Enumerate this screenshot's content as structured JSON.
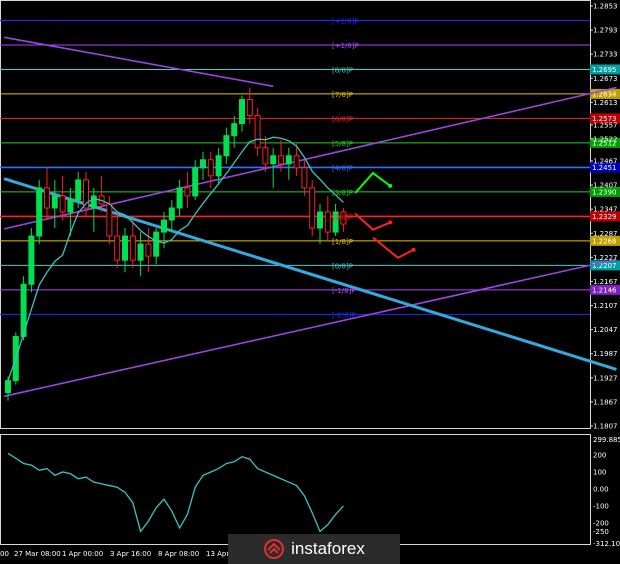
{
  "chart_data": [
    {
      "type": "candlestick",
      "title": "",
      "price_axis_ticks": [
        "1.2853",
        "1.2793",
        "1.2733",
        "1.2673",
        "1.2613",
        "1.2557",
        "1.2522",
        "1.2467",
        "1.2407",
        "1.2347",
        "1.2287",
        "1.2227",
        "1.2167",
        "1.2107",
        "1.2047",
        "1.1987",
        "1.1927",
        "1.1867",
        "1.1807"
      ],
      "time_axis_ticks": [
        "00",
        "27 Mar 08:00",
        "1 Apr 00:00",
        "3 Apr 16:00",
        "8 Apr 08:00",
        "13 Apr"
      ],
      "ylim": [
        1.1807,
        1.2853
      ],
      "grid": false,
      "price_tags": [
        {
          "value": "1.2695",
          "color": "#00a0a0"
        },
        {
          "value": "1.2634",
          "color": "#c0a000"
        },
        {
          "value": "1.2573",
          "color": "#c00000"
        },
        {
          "value": "1.2512",
          "color": "#00a000"
        },
        {
          "value": "1.2451",
          "color": "#0000c0"
        },
        {
          "value": "1.2390",
          "color": "#00a000"
        },
        {
          "value": "1.2329",
          "color": "#c00000"
        },
        {
          "value": "1.2268",
          "color": "#c0a000"
        },
        {
          "value": "1.2207",
          "color": "#00a0a0"
        },
        {
          "value": "1.2146",
          "color": "#8020c0"
        }
      ],
      "murrey_labels": [
        {
          "text": "[+2/8]P",
          "price": 1.2817,
          "color": "#1e2dff"
        },
        {
          "text": "[+1/8]P",
          "price": 1.2756,
          "color": "#b040ff"
        },
        {
          "text": "[8/8]P",
          "price": 1.2695,
          "color": "#40d0d0"
        },
        {
          "text": "[7/8]P",
          "price": 1.2634,
          "color": "#e6c200"
        },
        {
          "text": "[6/8]P",
          "price": 1.2573,
          "color": "#ff2020"
        },
        {
          "text": "[5/8]P",
          "price": 1.2512,
          "color": "#20d020"
        },
        {
          "text": "[4/8]P",
          "price": 1.2451,
          "color": "#3070ff"
        },
        {
          "text": "[3/8]P",
          "price": 1.239,
          "color": "#20d020"
        },
        {
          "text": "[2/8]P",
          "price": 1.2329,
          "color": "#ff2020"
        },
        {
          "text": "[1/8]P",
          "price": 1.2268,
          "color": "#e6c200"
        },
        {
          "text": "[0/8]P",
          "price": 1.2207,
          "color": "#40d0d0"
        },
        {
          "text": "[-1/8]P",
          "price": 1.2146,
          "color": "#b040ff"
        },
        {
          "text": "[-2/8]P",
          "price": 1.2085,
          "color": "#1e2dff"
        }
      ],
      "moving_average": {
        "color": "#40c0c0"
      },
      "trend_lines": [
        {
          "color": "#9b45e0",
          "from": [
            -0.5,
            1.2775
          ],
          "to": [
            34,
            1.2653
          ]
        },
        {
          "color": "#9b45e0",
          "from": [
            -0.5,
            1.2298
          ],
          "to": [
            78,
            1.265
          ]
        },
        {
          "color": "#9b45e0",
          "from": [
            -0.5,
            1.1881
          ],
          "to": [
            78,
            1.2222
          ]
        },
        {
          "color": "#33aadd",
          "from": [
            -0.5,
            1.2423
          ],
          "to": [
            78,
            1.1948
          ]
        }
      ],
      "forecast_arrows": [
        {
          "color": "#00ff00",
          "points": [
            [
              44.5,
              1.2387
            ],
            [
              46.8,
              1.2437
            ],
            [
              49.0,
              1.2405
            ]
          ]
        },
        {
          "color": "#ff2020",
          "points": [
            [
              44.5,
              1.2336
            ],
            [
              46.8,
              1.2296
            ],
            [
              49.0,
              1.2314
            ]
          ]
        },
        {
          "color": "#ff2020",
          "points": [
            [
              46.8,
              1.2276
            ],
            [
              50.0,
              1.2226
            ],
            [
              52.0,
              1.2246
            ]
          ]
        }
      ],
      "candles": [
        [
          1.189,
          1.193,
          1.187,
          1.192
        ],
        [
          1.192,
          1.204,
          1.191,
          1.203
        ],
        [
          1.203,
          1.218,
          1.202,
          1.216
        ],
        [
          1.216,
          1.23,
          1.214,
          1.228
        ],
        [
          1.228,
          1.242,
          1.226,
          1.24
        ],
        [
          1.24,
          1.245,
          1.232,
          1.235
        ],
        [
          1.235,
          1.242,
          1.23,
          1.238
        ],
        [
          1.238,
          1.243,
          1.232,
          1.234
        ],
        [
          1.234,
          1.24,
          1.228,
          1.237
        ],
        [
          1.237,
          1.244,
          1.235,
          1.242
        ],
        [
          1.242,
          1.244,
          1.233,
          1.235
        ],
        [
          1.235,
          1.24,
          1.229,
          1.238
        ],
        [
          1.238,
          1.243,
          1.234,
          1.236
        ],
        [
          1.236,
          1.238,
          1.226,
          1.228
        ],
        [
          1.228,
          1.234,
          1.22,
          1.222
        ],
        [
          1.222,
          1.23,
          1.219,
          1.228
        ],
        [
          1.228,
          1.232,
          1.22,
          1.222
        ],
        [
          1.222,
          1.229,
          1.218,
          1.226
        ],
        [
          1.226,
          1.23,
          1.219,
          1.223
        ],
        [
          1.223,
          1.23,
          1.221,
          1.229
        ],
        [
          1.229,
          1.234,
          1.225,
          1.232
        ],
        [
          1.232,
          1.237,
          1.229,
          1.235
        ],
        [
          1.235,
          1.242,
          1.233,
          1.24
        ],
        [
          1.24,
          1.244,
          1.235,
          1.238
        ],
        [
          1.238,
          1.247,
          1.237,
          1.245
        ],
        [
          1.245,
          1.249,
          1.242,
          1.247
        ],
        [
          1.247,
          1.249,
          1.24,
          1.243
        ],
        [
          1.243,
          1.25,
          1.241,
          1.248
        ],
        [
          1.248,
          1.255,
          1.246,
          1.253
        ],
        [
          1.253,
          1.258,
          1.25,
          1.256
        ],
        [
          1.256,
          1.263,
          1.254,
          1.262
        ],
        [
          1.262,
          1.265,
          1.256,
          1.258
        ],
        [
          1.258,
          1.26,
          1.248,
          1.25
        ],
        [
          1.25,
          1.253,
          1.244,
          1.246
        ],
        [
          1.246,
          1.25,
          1.24,
          1.248
        ],
        [
          1.248,
          1.252,
          1.244,
          1.246
        ],
        [
          1.246,
          1.25,
          1.242,
          1.248
        ],
        [
          1.248,
          1.251,
          1.243,
          1.245
        ],
        [
          1.245,
          1.247,
          1.238,
          1.24
        ],
        [
          1.24,
          1.242,
          1.228,
          1.23
        ],
        [
          1.23,
          1.236,
          1.226,
          1.234
        ],
        [
          1.234,
          1.238,
          1.227,
          1.229
        ],
        [
          1.229,
          1.236,
          1.228,
          1.234
        ],
        [
          1.234,
          1.235,
          1.229,
          1.231
        ]
      ]
    },
    {
      "type": "line",
      "title": "",
      "ylim": [
        -312.104,
        299.8858
      ],
      "top_value_label": "299.8858",
      "bottom_value_label": "-312.104",
      "y_ticks": [
        "200",
        "100",
        "0.00",
        "-100",
        "-200",
        "-250"
      ],
      "grid": false,
      "series": [
        {
          "color": "#40c0c0",
          "values": [
            210,
            180,
            150,
            140,
            110,
            120,
            80,
            100,
            90,
            60,
            70,
            40,
            30,
            20,
            10,
            -20,
            -80,
            -250,
            -190,
            -110,
            -60,
            -130,
            -230,
            -150,
            10,
            80,
            100,
            120,
            150,
            160,
            190,
            175,
            120,
            100,
            80,
            60,
            40,
            20,
            -40,
            -140,
            -250,
            -210,
            -150,
            -100
          ]
        }
      ]
    }
  ],
  "watermark": {
    "text": "instaforex",
    "icon": "instaforex-logo-icon"
  }
}
